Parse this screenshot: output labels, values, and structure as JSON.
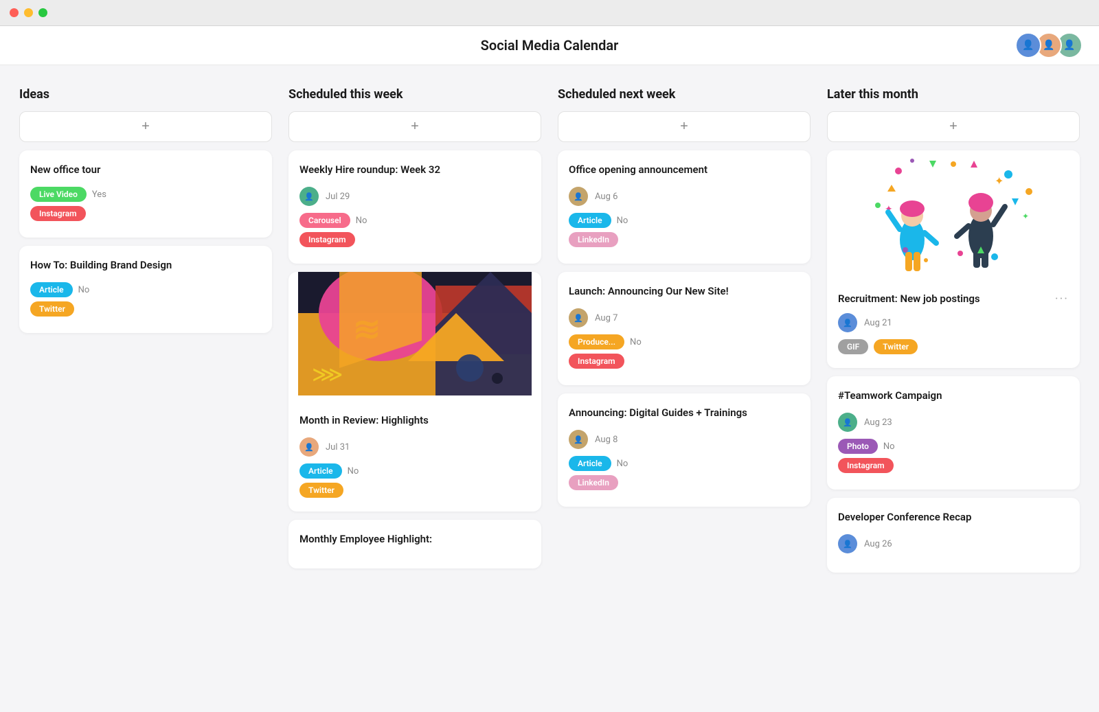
{
  "titlebar": {
    "dots": [
      "red",
      "yellow",
      "green"
    ]
  },
  "header": {
    "title": "Social Media Calendar",
    "avatars": [
      {
        "label": "A",
        "color_class": "avatar-1"
      },
      {
        "label": "B",
        "color_class": "avatar-2"
      },
      {
        "label": "C",
        "color_class": "avatar-3"
      }
    ]
  },
  "columns": [
    {
      "id": "ideas",
      "header": "Ideas",
      "cards": [
        {
          "id": "new-office-tour",
          "title": "New office tour",
          "badges": [
            {
              "label": "Live Video",
              "class": "badge-live-video"
            },
            {
              "label": "Yes",
              "type": "value"
            },
            {
              "label": "Instagram",
              "class": "badge-instagram"
            }
          ],
          "has_avatar": false,
          "date": ""
        },
        {
          "id": "building-brand",
          "title": "How To: Building Brand Design",
          "badges": [
            {
              "label": "Article",
              "class": "badge-article"
            },
            {
              "label": "No",
              "type": "value"
            },
            {
              "label": "Twitter",
              "class": "badge-twitter"
            }
          ],
          "has_avatar": false,
          "date": ""
        }
      ]
    },
    {
      "id": "scheduled-this-week",
      "header": "Scheduled this week",
      "cards": [
        {
          "id": "weekly-hire",
          "title": "Weekly Hire roundup: Week 32",
          "avatar_color": "#4caf8a",
          "date": "Jul 29",
          "badges": [
            {
              "label": "Carousel",
              "class": "badge-carousel"
            },
            {
              "label": "No",
              "type": "value"
            },
            {
              "label": "Instagram",
              "class": "badge-instagram"
            }
          ],
          "has_image": false
        },
        {
          "id": "month-review",
          "title": "Month in Review: Highlights",
          "avatar_color": "#e8a87c",
          "date": "Jul 31",
          "badges": [
            {
              "label": "Article",
              "class": "badge-article"
            },
            {
              "label": "No",
              "type": "value"
            },
            {
              "label": "Twitter",
              "class": "badge-twitter"
            }
          ],
          "has_image": true,
          "image_type": "review"
        },
        {
          "id": "monthly-employee",
          "title": "Monthly Employee Highlight:",
          "has_image": false,
          "avatar_color": "",
          "date": "",
          "badges": []
        }
      ]
    },
    {
      "id": "scheduled-next-week",
      "header": "Scheduled next week",
      "cards": [
        {
          "id": "office-opening",
          "title": "Office opening announcement",
          "avatar_color": "#c4a46b",
          "date": "Aug 6",
          "badges": [
            {
              "label": "Article",
              "class": "badge-article"
            },
            {
              "label": "No",
              "type": "value"
            },
            {
              "label": "LinkedIn",
              "class": "badge-linkedin"
            }
          ]
        },
        {
          "id": "launch-new-site",
          "title": "Launch: Announcing Our New Site!",
          "avatar_color": "#c4a46b",
          "date": "Aug 7",
          "badges": [
            {
              "label": "Produce...",
              "class": "badge-producer"
            },
            {
              "label": "No",
              "type": "value"
            },
            {
              "label": "Instagram",
              "class": "badge-instagram"
            }
          ]
        },
        {
          "id": "digital-guides",
          "title": "Announcing: Digital Guides + Trainings",
          "avatar_color": "#c4a46b",
          "date": "Aug 8",
          "badges": [
            {
              "label": "Article",
              "class": "badge-article"
            },
            {
              "label": "No",
              "type": "value"
            },
            {
              "label": "LinkedIn",
              "class": "badge-linkedin"
            }
          ],
          "has_image": false
        }
      ]
    },
    {
      "id": "later-this-month",
      "header": "Later this month",
      "cards": [
        {
          "id": "recruitment",
          "title": "Recruitment: New job postings",
          "avatar_color": "#5b8dd9",
          "date": "Aug 21",
          "badges": [
            {
              "label": "GIF",
              "class": "badge-gif"
            },
            {
              "label": "Twitter",
              "class": "badge-twitter-orange"
            }
          ],
          "has_celebration": true,
          "has_more": true
        },
        {
          "id": "teamwork-campaign",
          "title": "#Teamwork Campaign",
          "avatar_color": "#4caf8a",
          "date": "Aug 23",
          "badges": [
            {
              "label": "Photo",
              "class": "badge-photo"
            },
            {
              "label": "No",
              "type": "value"
            },
            {
              "label": "Instagram",
              "class": "badge-instagram"
            }
          ]
        },
        {
          "id": "developer-conf",
          "title": "Developer Conference Recap",
          "avatar_color": "#5b8dd9",
          "date": "Aug 26",
          "badges": []
        }
      ]
    }
  ],
  "add_button_label": "+"
}
